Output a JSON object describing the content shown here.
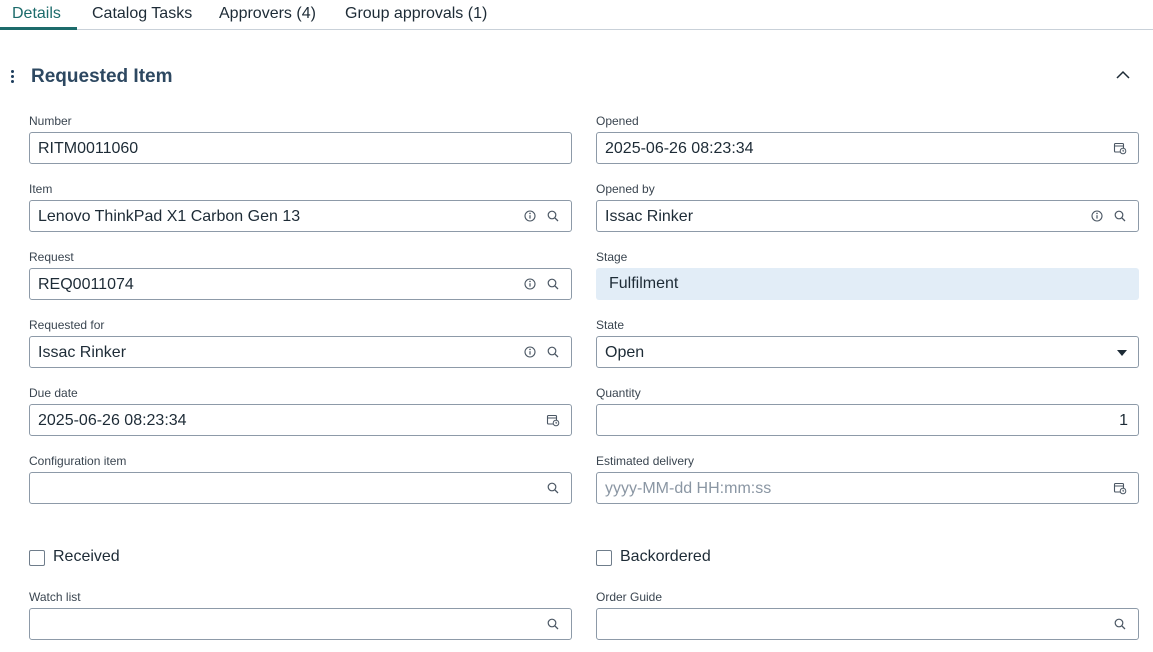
{
  "tabs": [
    {
      "label": "Details",
      "active": true
    },
    {
      "label": "Catalog Tasks"
    },
    {
      "label": "Approvers (4)"
    },
    {
      "label": "Group approvals (1)"
    }
  ],
  "section": {
    "title": "Requested Item",
    "collapse_icon": "chevron-up-icon",
    "menu_icon": "vertical-ellipsis-icon"
  },
  "fields": {
    "number": {
      "label": "Number",
      "value": "RITM0011060"
    },
    "opened": {
      "label": "Opened",
      "value": "2025-06-26 08:23:34"
    },
    "item": {
      "label": "Item",
      "value": "Lenovo ThinkPad X1 Carbon Gen 13"
    },
    "opened_by": {
      "label": "Opened by",
      "value": "Issac Rinker"
    },
    "request": {
      "label": "Request",
      "value": "REQ0011074"
    },
    "stage": {
      "label": "Stage",
      "value": "Fulfilment"
    },
    "requested_for": {
      "label": "Requested for",
      "value": "Issac Rinker"
    },
    "state": {
      "label": "State",
      "value": "Open"
    },
    "due_date": {
      "label": "Due date",
      "value": "2025-06-26 08:23:34"
    },
    "quantity": {
      "label": "Quantity",
      "value": "1"
    },
    "configuration_item": {
      "label": "Configuration item",
      "value": ""
    },
    "estimated_delivery": {
      "label": "Estimated delivery",
      "value": "",
      "placeholder": "yyyy-MM-dd HH:mm:ss"
    },
    "watch_list": {
      "label": "Watch list",
      "value": ""
    },
    "order_guide": {
      "label": "Order Guide",
      "value": ""
    }
  },
  "checkboxes": {
    "received": {
      "label": "Received",
      "checked": false
    },
    "backordered": {
      "label": "Backordered",
      "checked": false
    }
  },
  "colors": {
    "accent": "#1c6b6b",
    "readonly_bg": "#e2edf7",
    "heading": "#2d4861"
  }
}
